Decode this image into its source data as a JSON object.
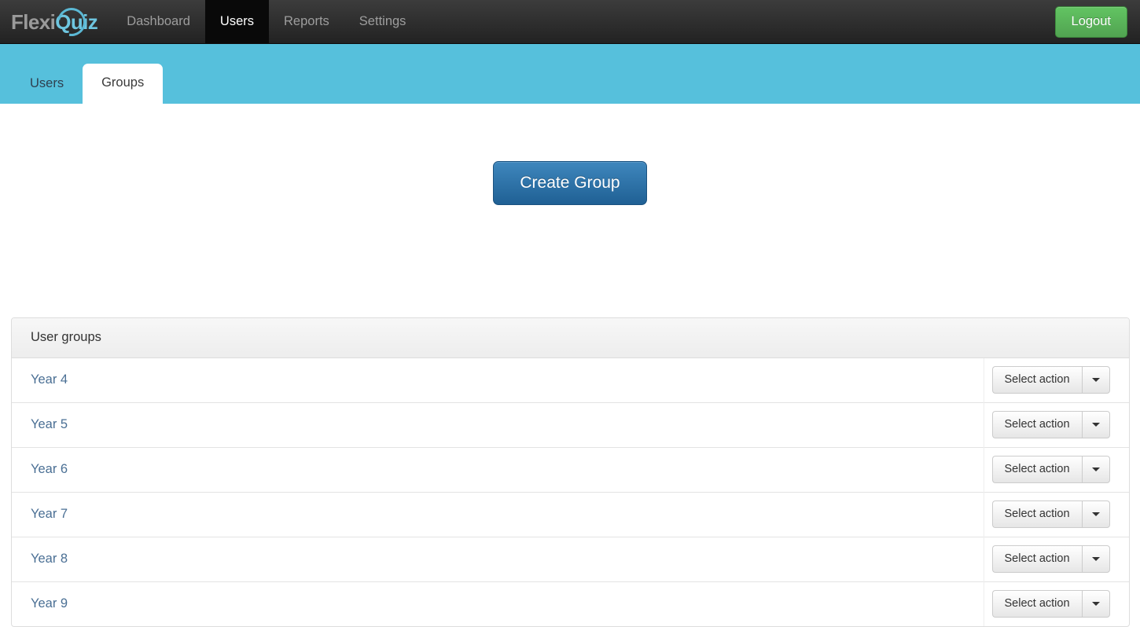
{
  "navbar": {
    "brand": {
      "part1": "Flexi",
      "part2": "Quiz"
    },
    "links": [
      {
        "label": "Dashboard",
        "active": false
      },
      {
        "label": "Users",
        "active": true
      },
      {
        "label": "Reports",
        "active": false
      },
      {
        "label": "Settings",
        "active": false
      }
    ],
    "logout_label": "Logout",
    "colors": {
      "logout_green": "#51a351",
      "active_tab_bg": "#090909"
    }
  },
  "subnav": {
    "bg_color": "#56c0dc",
    "tabs": [
      {
        "label": "Users",
        "active": false
      },
      {
        "label": "Groups",
        "active": true
      }
    ]
  },
  "main": {
    "create_button_label": "Create Group",
    "create_button_color": "#1f6094",
    "panel": {
      "heading": "User groups",
      "rows": [
        {
          "name": "Year 4",
          "action_label": "Select action"
        },
        {
          "name": "Year 5",
          "action_label": "Select action"
        },
        {
          "name": "Year 6",
          "action_label": "Select action"
        },
        {
          "name": "Year 7",
          "action_label": "Select action"
        },
        {
          "name": "Year 8",
          "action_label": "Select action"
        },
        {
          "name": "Year 9",
          "action_label": "Select action"
        }
      ]
    }
  }
}
